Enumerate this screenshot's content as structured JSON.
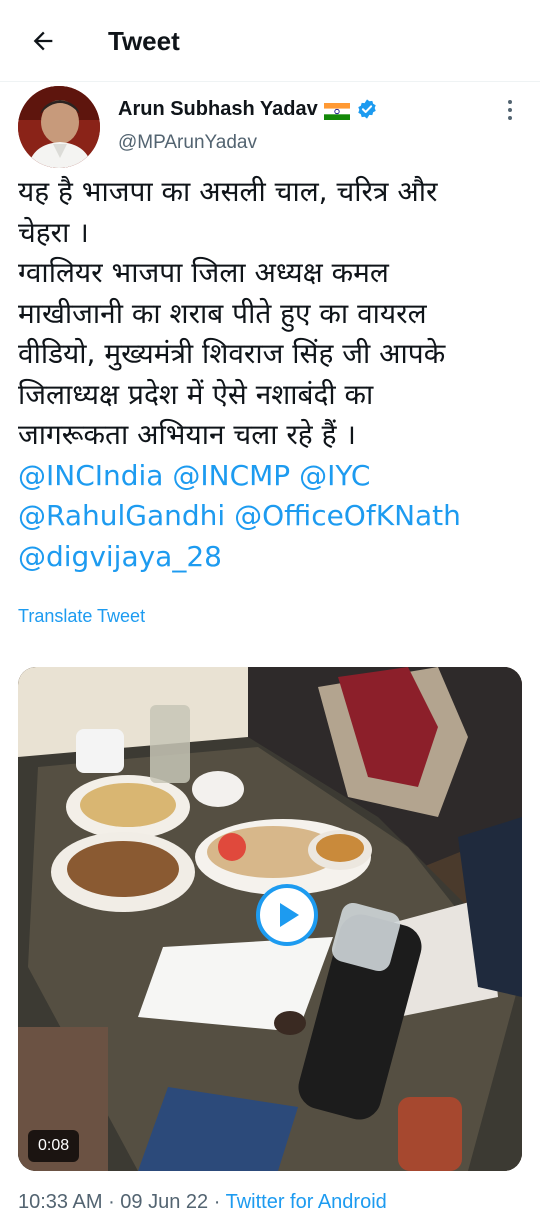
{
  "header": {
    "title": "Tweet",
    "back_icon": "arrow-left-icon"
  },
  "author": {
    "name": "Arun Subhash Yadav",
    "flag": "india-flag-emoji",
    "verified": true,
    "handle": "@MPArunYadav"
  },
  "tweet": {
    "lines": [
      "यह है भाजपा का असली चाल, चरित्र और",
      "चेहरा ।",
      "ग्वालियर भाजपा जिला अध्यक्ष कमल",
      "माखीजानी का शराब पीते हुए का वायरल",
      "वीडियो, मुख्यमंत्री शिवराज सिंह जी आपके",
      "जिलाध्यक्ष प्रदेश में ऐसे नशाबंदी का",
      "जागरूकता अभियान चला रहे हैं ।"
    ],
    "mentions": [
      "@INCIndia",
      "@INCMP",
      "@IYC",
      "@RahulGandhi",
      "@OfficeOfKNath",
      "@digvijaya_28"
    ],
    "translate_label": "Translate Tweet"
  },
  "media": {
    "type": "video",
    "duration": "0:08"
  },
  "meta": {
    "time": "10:33 AM",
    "separator": " · ",
    "date": "09 Jun 22",
    "source": "Twitter for Android"
  },
  "colors": {
    "accent": "#1d9bf0",
    "text": "#0f1419",
    "secondary": "#536471"
  }
}
